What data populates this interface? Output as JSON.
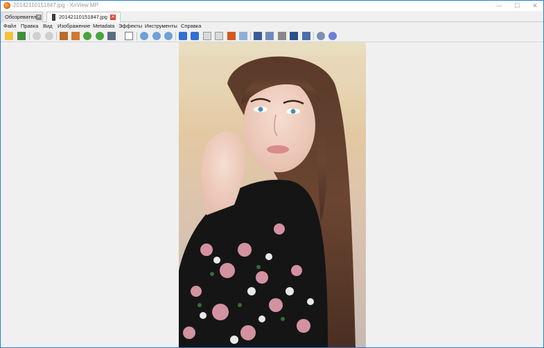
{
  "window": {
    "title": "20142110151847.jpg - XnView MP",
    "controls": {
      "minimize": "—",
      "maximize": "☐",
      "close": "✕"
    }
  },
  "tabs": [
    {
      "label": "Обозреватель",
      "active": false
    },
    {
      "label": "20142110151847.jpg",
      "active": true
    }
  ],
  "menu": {
    "items": [
      "Файл",
      "Правка",
      "Вид",
      "Изображение",
      "Metadata",
      "Эффекты",
      "Инструменты",
      "Справка"
    ]
  },
  "toolbar": {
    "buttons": [
      "open-folder-icon",
      "save-icon",
      "undo-icon",
      "redo-icon",
      "crop-icon",
      "resize-icon",
      "rotate-left-icon",
      "rotate-right-icon",
      "adjust-menu-icon",
      "levels-icon",
      "zoom-in-icon",
      "zoom-fit-icon",
      "zoom-out-icon",
      "previous-icon",
      "next-icon",
      "first-page-icon",
      "last-page-icon",
      "slideshow-icon",
      "copy-icon",
      "fullscreen-icon",
      "edit-icon",
      "print-icon",
      "wallpaper-icon",
      "properties-icon",
      "settings-icon",
      "help-icon"
    ]
  },
  "viewer": {
    "image_alt": "Portrait photo of a woman with long brown hair in a black floral blouse"
  },
  "colors": {
    "window_border": "#2b79d6",
    "close_tab": "#e24a2e",
    "toolbar_blue": "#2f6fd1"
  }
}
